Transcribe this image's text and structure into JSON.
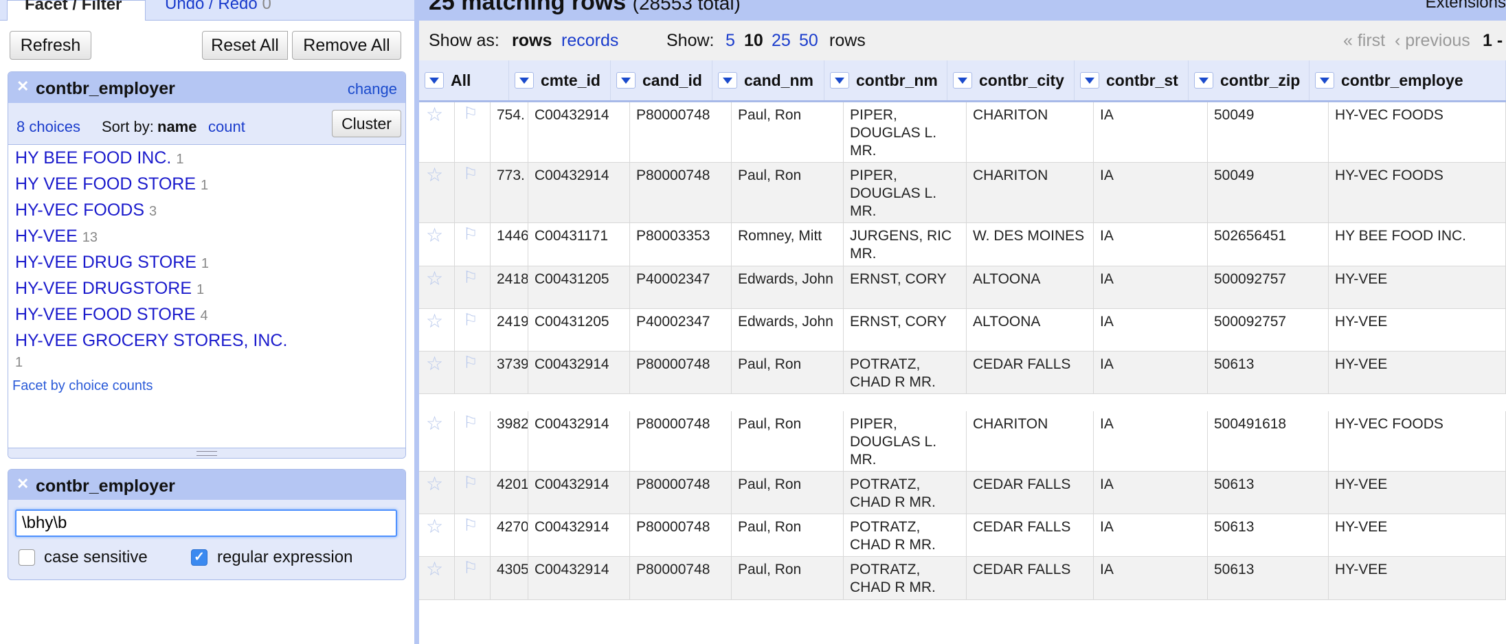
{
  "left_tabs": {
    "facet_filter": "Facet / Filter",
    "undo_redo": "Undo / Redo",
    "undo_count": "0"
  },
  "buttons": {
    "refresh": "Refresh",
    "reset_all": "Reset All",
    "remove_all": "Remove All"
  },
  "facet1": {
    "title": "contbr_employer",
    "change": "change",
    "choices_count": "8 choices",
    "sort_by": "Sort by:",
    "sort_name": "name",
    "sort_count": "count",
    "cluster": "Cluster",
    "choices": [
      {
        "label": "HY BEE FOOD INC.",
        "count": "1"
      },
      {
        "label": "HY VEE FOOD STORE",
        "count": "1"
      },
      {
        "label": "HY-VEC FOODS",
        "count": "3"
      },
      {
        "label": "HY-VEE",
        "count": "13"
      },
      {
        "label": "HY-VEE DRUG STORE",
        "count": "1"
      },
      {
        "label": "HY-VEE DRUGSTORE",
        "count": "1"
      },
      {
        "label": "HY-VEE FOOD STORE",
        "count": "4"
      },
      {
        "label": "HY-VEE GROCERY STORES, INC.",
        "count": "1"
      }
    ],
    "facet_by_counts": "Facet by choice counts"
  },
  "facet2": {
    "title": "contbr_employer",
    "regex_value": "\\bhy\\b",
    "case_sensitive_label": "case sensitive",
    "case_sensitive": false,
    "regex_label": "regular expression",
    "regex": true
  },
  "header": {
    "matching": "25 matching rows",
    "total": "(28553 total)",
    "extensions": "Extensions"
  },
  "viewbar": {
    "show_as": "Show as:",
    "rows": "rows",
    "records": "records",
    "show": "Show:",
    "sizes": [
      "5",
      "10",
      "25",
      "50"
    ],
    "selected_size": "10",
    "rows_suffix": "rows",
    "first": "« first",
    "previous": "‹ previous",
    "range": "1 -"
  },
  "columns": [
    "All",
    "cmte_id",
    "cand_id",
    "cand_nm",
    "contbr_nm",
    "contbr_city",
    "contbr_st",
    "contbr_zip",
    "contbr_employe"
  ],
  "rows": [
    {
      "idx": "754.",
      "cmte_id": "C00432914",
      "cand_id": "P80000748",
      "cand_nm": "Paul, Ron",
      "contbr_nm": "PIPER, DOUGLAS L. MR.",
      "contbr_city": "CHARITON",
      "contbr_st": "IA",
      "contbr_zip": "50049",
      "contbr_employer": "HY-VEC FOODS"
    },
    {
      "idx": "773.",
      "cmte_id": "C00432914",
      "cand_id": "P80000748",
      "cand_nm": "Paul, Ron",
      "contbr_nm": "PIPER, DOUGLAS L. MR.",
      "contbr_city": "CHARITON",
      "contbr_st": "IA",
      "contbr_zip": "50049",
      "contbr_employer": "HY-VEC FOODS"
    },
    {
      "idx": "1446.",
      "cmte_id": "C00431171",
      "cand_id": "P80003353",
      "cand_nm": "Romney, Mitt",
      "contbr_nm": "JURGENS, RIC MR.",
      "contbr_city": "W. DES MOINES",
      "contbr_st": "IA",
      "contbr_zip": "502656451",
      "contbr_employer": "HY BEE FOOD INC."
    },
    {
      "idx": "2418.",
      "cmte_id": "C00431205",
      "cand_id": "P40002347",
      "cand_nm": "Edwards, John",
      "contbr_nm": "ERNST, CORY",
      "contbr_city": "ALTOONA",
      "contbr_st": "IA",
      "contbr_zip": "500092757",
      "contbr_employer": "HY-VEE"
    },
    {
      "idx": "2419.",
      "cmte_id": "C00431205",
      "cand_id": "P40002347",
      "cand_nm": "Edwards, John",
      "contbr_nm": "ERNST, CORY",
      "contbr_city": "ALTOONA",
      "contbr_st": "IA",
      "contbr_zip": "500092757",
      "contbr_employer": "HY-VEE"
    },
    {
      "idx": "3739.",
      "cmte_id": "C00432914",
      "cand_id": "P80000748",
      "cand_nm": "Paul, Ron",
      "contbr_nm": "POTRATZ, CHAD R MR.",
      "contbr_city": "CEDAR FALLS",
      "contbr_st": "IA",
      "contbr_zip": "50613",
      "contbr_employer": "HY-VEE"
    },
    {
      "idx": "3982.",
      "cmte_id": "C00432914",
      "cand_id": "P80000748",
      "cand_nm": "Paul, Ron",
      "contbr_nm": "PIPER, DOUGLAS L. MR.",
      "contbr_city": "CHARITON",
      "contbr_st": "IA",
      "contbr_zip": "500491618",
      "contbr_employer": "HY-VEC FOODS"
    },
    {
      "idx": "4201.",
      "cmte_id": "C00432914",
      "cand_id": "P80000748",
      "cand_nm": "Paul, Ron",
      "contbr_nm": "POTRATZ, CHAD R MR.",
      "contbr_city": "CEDAR FALLS",
      "contbr_st": "IA",
      "contbr_zip": "50613",
      "contbr_employer": "HY-VEE"
    },
    {
      "idx": "4270.",
      "cmte_id": "C00432914",
      "cand_id": "P80000748",
      "cand_nm": "Paul, Ron",
      "contbr_nm": "POTRATZ, CHAD R MR.",
      "contbr_city": "CEDAR FALLS",
      "contbr_st": "IA",
      "contbr_zip": "50613",
      "contbr_employer": "HY-VEE"
    },
    {
      "idx": "4305.",
      "cmte_id": "C00432914",
      "cand_id": "P80000748",
      "cand_nm": "Paul, Ron",
      "contbr_nm": "POTRATZ, CHAD R MR.",
      "contbr_city": "CEDAR FALLS",
      "contbr_st": "IA",
      "contbr_zip": "50613",
      "contbr_employer": "HY-VEE"
    }
  ]
}
